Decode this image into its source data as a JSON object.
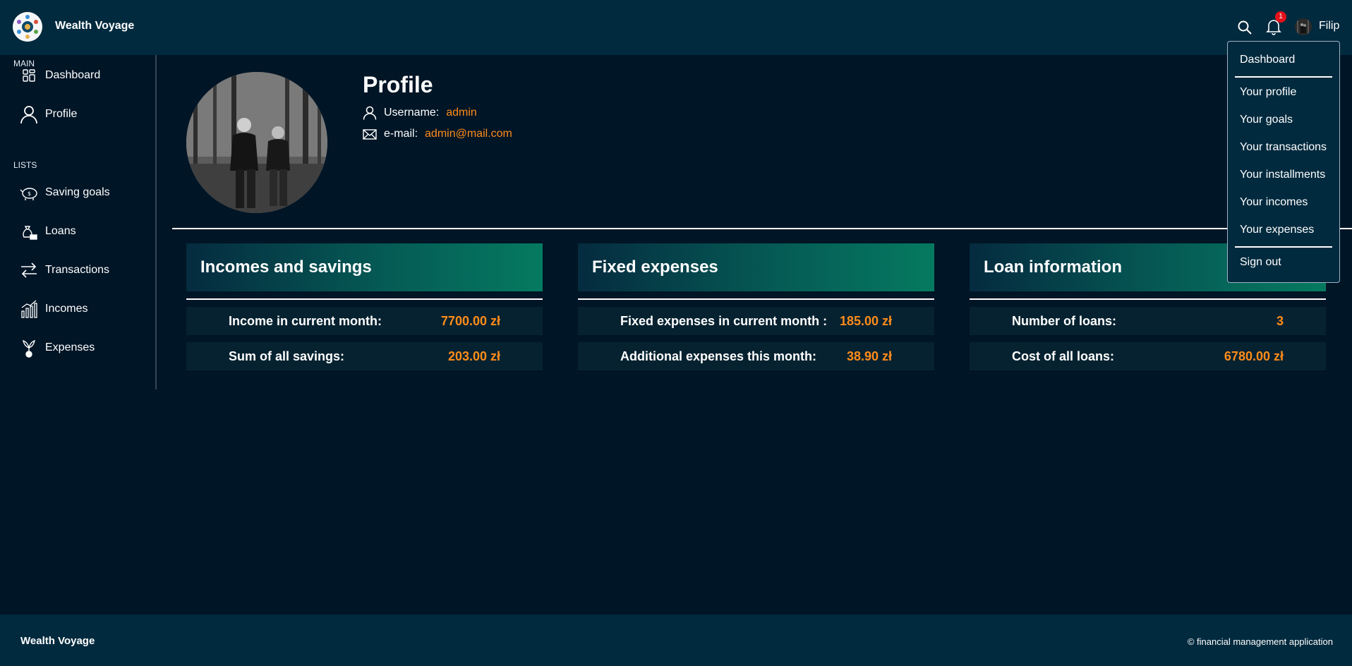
{
  "app": {
    "brand": "Wealth Voyage",
    "accent_color": "#ff8c1a",
    "header_bg": "#022a3e",
    "page_bg": "#001526"
  },
  "header": {
    "notifications_count": "1",
    "user_name": "Filip",
    "icons": [
      "search-icon",
      "bell-icon",
      "avatar"
    ]
  },
  "sidebar": {
    "sections": [
      {
        "title": "MAIN",
        "items": [
          {
            "label": "Dashboard",
            "icon": "dashboard-icon"
          },
          {
            "label": "Profile",
            "icon": "user-icon"
          }
        ]
      },
      {
        "title": "LISTS",
        "items": [
          {
            "label": "Saving goals",
            "icon": "piggy-bank-icon"
          },
          {
            "label": "Loans",
            "icon": "money-bag-icon"
          },
          {
            "label": "Transactions",
            "icon": "arrows-exchange-icon"
          },
          {
            "label": "Incomes",
            "icon": "bar-chart-icon"
          },
          {
            "label": "Expenses",
            "icon": "money-plant-icon"
          }
        ]
      }
    ]
  },
  "profile": {
    "title": "Profile",
    "username_label": "Username:",
    "username": "admin",
    "email_label": "e-mail:",
    "email": "admin@mail.com"
  },
  "cards": [
    {
      "title": "Incomes and savings",
      "rows": [
        {
          "label": "Income in current month:",
          "value": "7700.00 zł"
        },
        {
          "label": "Sum of all savings:",
          "value": "203.00 zł"
        }
      ]
    },
    {
      "title": "Fixed expenses",
      "rows": [
        {
          "label": "Fixed expenses in current month :",
          "value": "185.00 zł"
        },
        {
          "label": "Additional expenses this month:",
          "value": "38.90 zł"
        }
      ]
    },
    {
      "title": "Loan information",
      "rows": [
        {
          "label": "Number of loans:",
          "value": "3"
        },
        {
          "label": "Cost of all loans:",
          "value": "6780.00 zł"
        }
      ]
    }
  ],
  "user_menu": {
    "items": [
      "Dashboard",
      "Your profile",
      "Your goals",
      "Your transactions",
      "Your installments",
      "Your incomes",
      "Your expenses",
      "Sign out"
    ]
  },
  "footer": {
    "brand": "Wealth Voyage",
    "copyright": "© financial management application"
  }
}
